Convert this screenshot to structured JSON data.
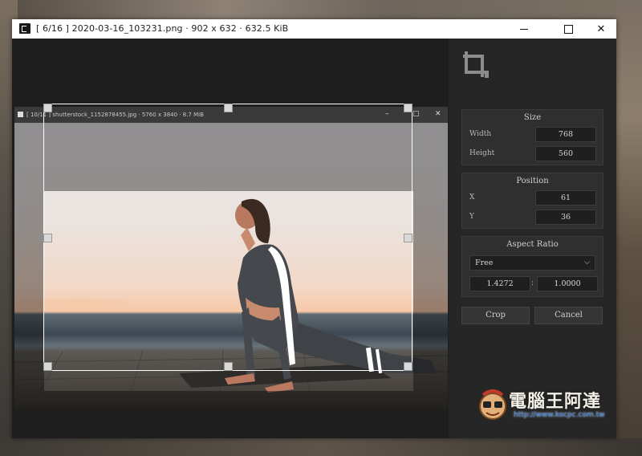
{
  "window": {
    "title": "[ 6/16 ]  2020-03-16_103231.png  ·  902 x 632  ·  632.5 KiB"
  },
  "inner_window": {
    "title": "[ 10/11 ]  shutterstock_1152878455.jpg  ·  5760 x 3840  ·  8.7 MiB"
  },
  "panel": {
    "size": {
      "title": "Size",
      "width_label": "Width",
      "width_value": "768",
      "height_label": "Height",
      "height_value": "560"
    },
    "position": {
      "title": "Position",
      "x_label": "X",
      "x_value": "61",
      "y_label": "Y",
      "y_value": "36"
    },
    "aspect_ratio": {
      "title": "Aspect Ratio",
      "selected": "Free",
      "ratio_w": "1.4272",
      "separator": ":",
      "ratio_h": "1.0000"
    },
    "crop_label": "Crop",
    "cancel_label": "Cancel"
  },
  "watermark": {
    "text": "電腦王阿達",
    "url": "http://www.kocpc.com.tw"
  },
  "icons": {
    "app": "app-icon",
    "crop": "crop-icon",
    "minimize": "minimize-icon",
    "maximize": "maximize-icon",
    "close": "close-icon",
    "dropdown": "chevron-down-icon"
  }
}
